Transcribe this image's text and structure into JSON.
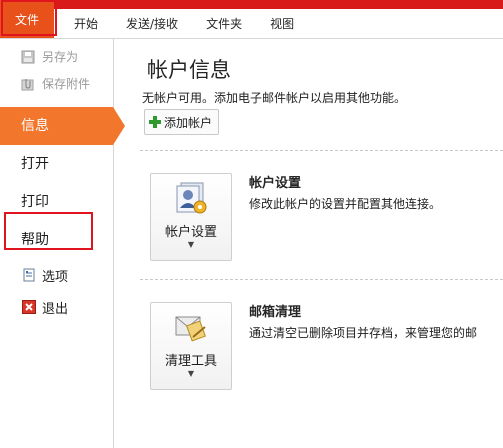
{
  "ribbon": {
    "tabs": [
      {
        "label": "文件"
      },
      {
        "label": "开始"
      },
      {
        "label": "发送/接收"
      },
      {
        "label": "文件夹"
      },
      {
        "label": "视图"
      }
    ]
  },
  "nav": {
    "save_as": "另存为",
    "save_attachments": "保存附件",
    "info": "信息",
    "open": "打开",
    "print": "打印",
    "help": "帮助",
    "options": "选项",
    "exit": "退出"
  },
  "main": {
    "title": "帐户信息",
    "subtitle": "无帐户可用。添加电子邮件帐户以启用其他功能。",
    "add_account": "添加帐户",
    "account_settings": {
      "button_label": "帐户设置",
      "title": "帐户设置",
      "description": "修改此帐户的设置并配置其他连接。"
    },
    "mailbox_cleanup": {
      "button_label": "清理工具",
      "title": "邮箱清理",
      "description": "通过清空已删除项目并存档，来管理您的邮"
    }
  },
  "colors": {
    "file_tab": "#e8511a",
    "active_nav": "#f2762c",
    "highlight_box": "#e0141e",
    "top_strip": "#d91a1a"
  },
  "icons": [
    "save-as-icon",
    "paperclip-icon",
    "options-icon",
    "exit-icon",
    "plus-icon",
    "account-settings-icon",
    "cleanup-tools-icon",
    "caret-down-icon"
  ]
}
